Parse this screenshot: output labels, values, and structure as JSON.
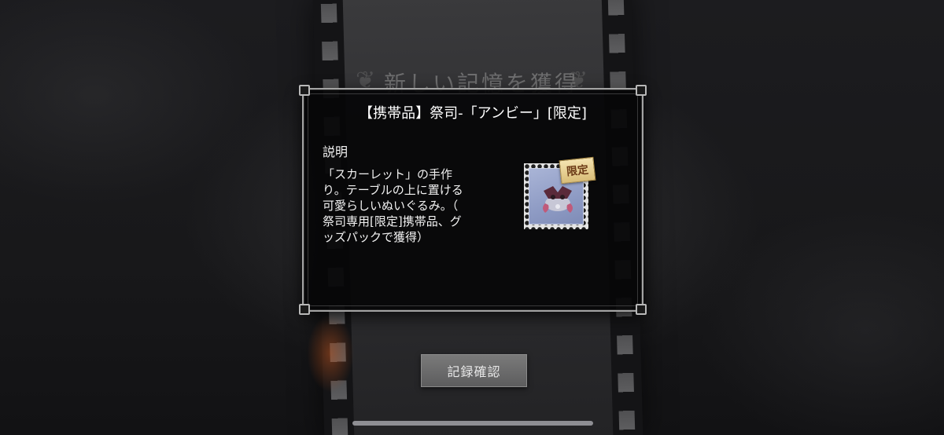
{
  "background": {
    "title": "新しい記憶を獲得"
  },
  "dialog": {
    "title": "【携帯品】祭司-「アンビー」[限定]",
    "description_heading": "説明",
    "description_text": "「スカーレット」の手作\nり。テーブルの上に置ける\n可愛らしいぬいぐるみ。（\n祭司専用[限定]携帯品、グ\nッズパックで獲得）",
    "item_tag": "限定"
  },
  "buttons": {
    "confirm_record": "記録確認"
  },
  "colors": {
    "dialog_border": "#a3a3a3",
    "tag_gold": "#d9bd78",
    "stamp_blue": "#8e9bc4"
  }
}
